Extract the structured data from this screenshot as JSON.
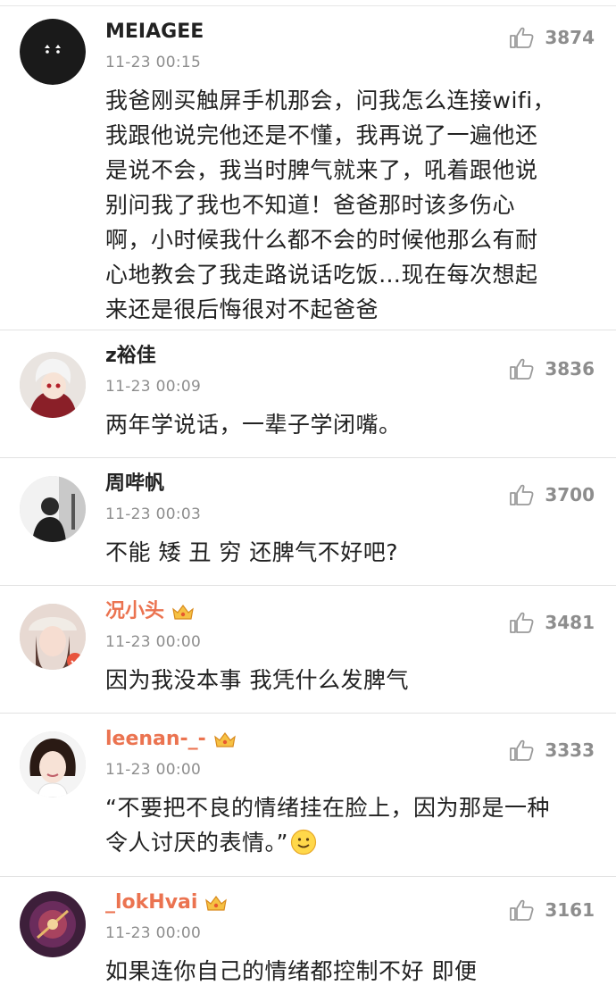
{
  "comments": [
    {
      "user": "MEIAGEE",
      "time": "11-23 00:15",
      "likes": "3874",
      "text_lines": [
        "我爸刚买触屏手机那会，问我怎么连接wifi，",
        "我跟他说完他还是不懂，我再说了一遍他还",
        "是说不会，我当时脾气就来了，吼着跟他说",
        "别问我了我也不知道！爸爸那时该多伤心",
        "啊，小时候我什么都不会的时候他那么有耐",
        "心地教会了我走路说话吃饭…现在每次想起",
        "来还是很后悔很对不起爸爸"
      ],
      "avatar": "black-cat-avatar"
    },
    {
      "user": "z裕佳",
      "time": "11-23 00:09",
      "likes": "3836",
      "text_lines": [
        "两年学说话，一辈子学闭嘴。"
      ],
      "avatar": "anime-avatar"
    },
    {
      "user": "周哔帆",
      "time": "11-23 00:03",
      "likes": "3700",
      "text_lines": [
        "不能 矮 丑 穷 还脾气不好吧?"
      ],
      "avatar": "photo-person-avatar"
    },
    {
      "user": "况小头",
      "time": "11-23 00:00",
      "likes": "3481",
      "text_lines": [
        "因为我没本事 我凭什么发脾气"
      ],
      "avatar": "girl-hat-avatar",
      "vip": true
    },
    {
      "user": "leenan-_-",
      "time": "11-23 00:00",
      "likes": "3333",
      "text_lines": [
        "“不要把不良的情绪挂在脸上，因为那是一种",
        "令人讨厌的表情。”"
      ],
      "avatar": "girl-avatar",
      "vip": true,
      "emoji": "smile-emoji"
    },
    {
      "user": "_lokHvai",
      "time": "11-23 00:00",
      "likes": "3161",
      "text_lines": [
        "如果连你自己的情绪都控制不好 即便"
      ],
      "avatar": "purple-avatar",
      "vip": true
    }
  ]
}
